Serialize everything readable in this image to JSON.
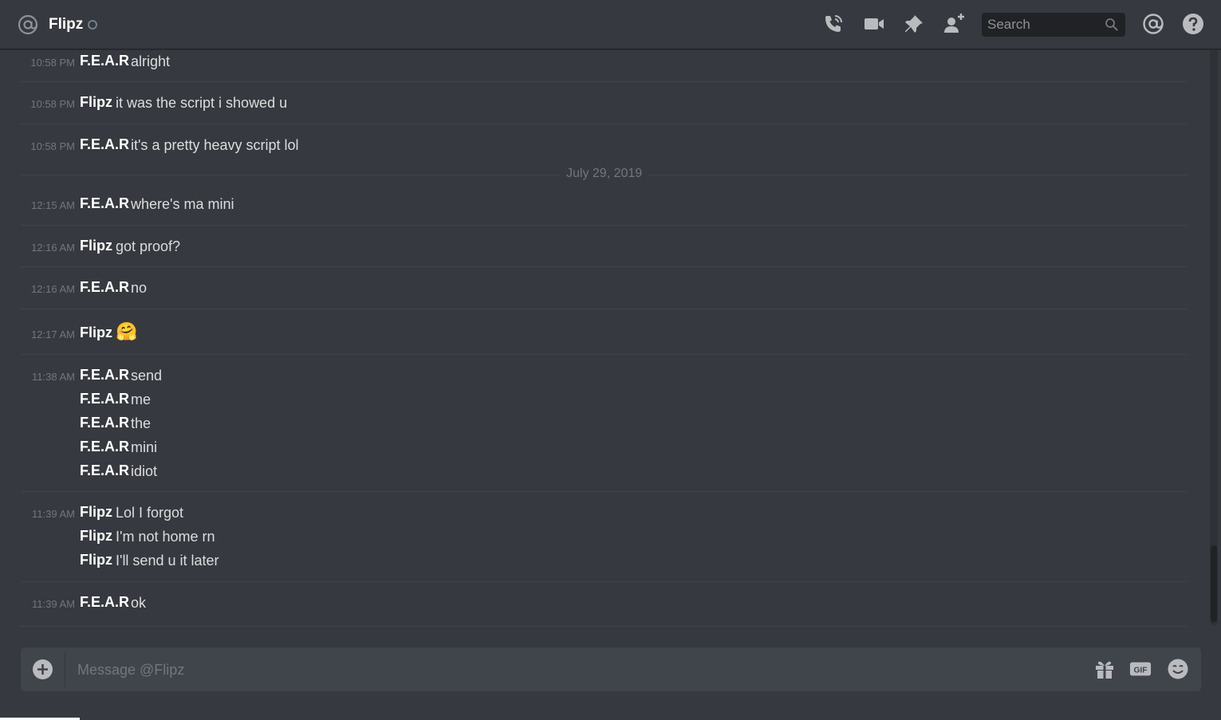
{
  "header": {
    "channel_name": "Flipz",
    "search_placeholder": "Search"
  },
  "date_divider": "July 29, 2019",
  "composer": {
    "placeholder": "Message @Flipz"
  },
  "messages": [
    {
      "time": "10:58 PM",
      "author": "F.E.A.R",
      "lines": [
        "alright"
      ]
    },
    {
      "time": "10:58 PM",
      "author": "Flipz",
      "lines": [
        "it was the script i showed u"
      ]
    },
    {
      "time": "10:58 PM",
      "author": "F.E.A.R",
      "lines": [
        "it's a pretty heavy script lol"
      ]
    },
    {
      "time": "12:15 AM",
      "author": "F.E.A.R",
      "lines": [
        "where's ma mini"
      ]
    },
    {
      "time": "12:16 AM",
      "author": "Flipz",
      "lines": [
        "got proof?"
      ]
    },
    {
      "time": "12:16 AM",
      "author": "F.E.A.R",
      "lines": [
        "no"
      ]
    },
    {
      "time": "12:17 AM",
      "author": "Flipz",
      "lines": [
        "🤗"
      ]
    },
    {
      "time": "11:38 AM",
      "author": "F.E.A.R",
      "lines": [
        "send",
        "me",
        "the",
        "mini",
        "idiot"
      ]
    },
    {
      "time": "11:39 AM",
      "author": "Flipz",
      "lines": [
        "Lol I forgot",
        "I'm not home rn",
        "I'll send u it later"
      ]
    },
    {
      "time": "11:39 AM",
      "author": "F.E.A.R",
      "lines": [
        "ok"
      ]
    }
  ],
  "icons": {
    "header": [
      "at-icon",
      "status-offline-icon",
      "voice-call-icon",
      "video-call-icon",
      "pin-icon",
      "add-friend-icon",
      "search-icon",
      "mentions-icon",
      "help-icon"
    ],
    "composer": [
      "add-attachment-icon",
      "gift-icon",
      "gif-icon",
      "emoji-icon"
    ]
  }
}
